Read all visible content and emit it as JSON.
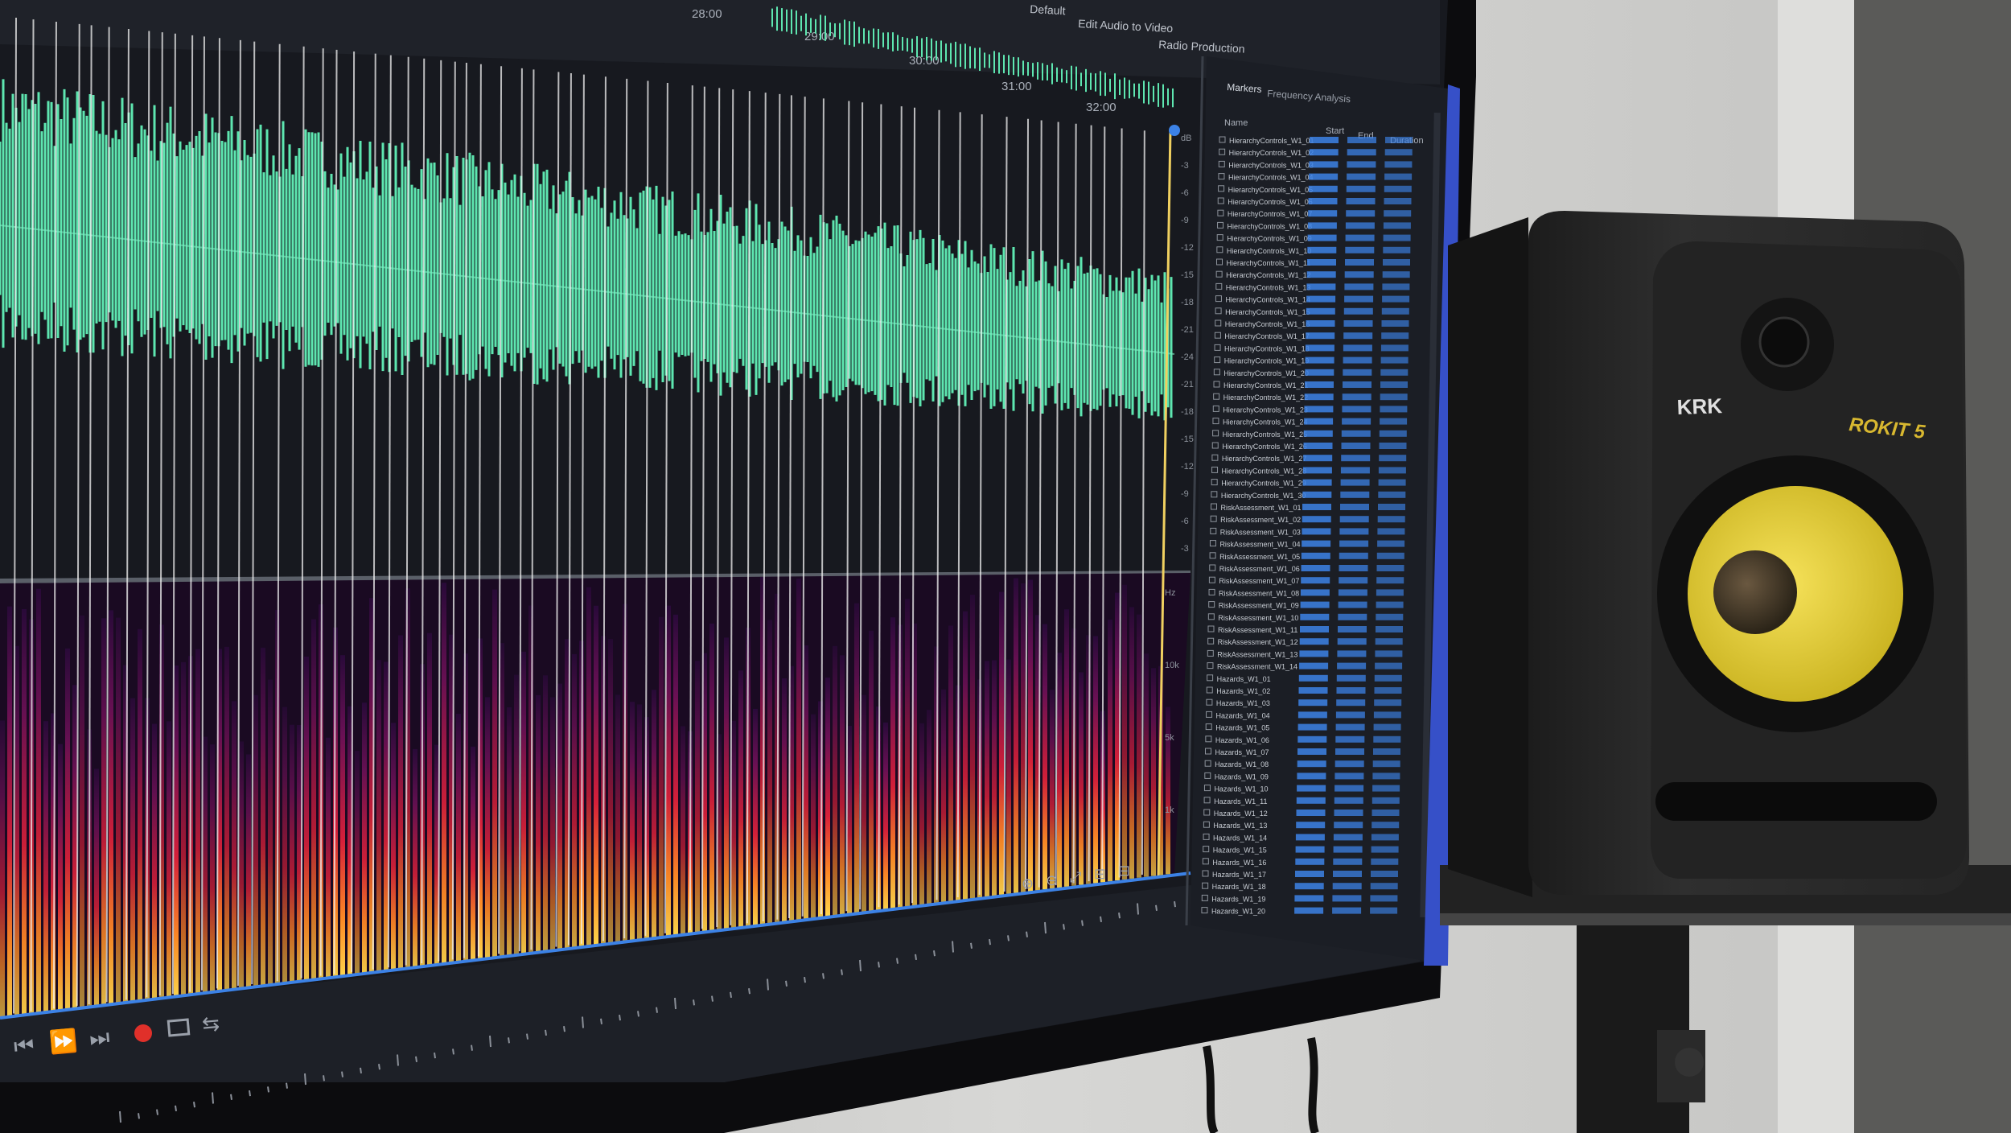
{
  "editor": {
    "workspaces": [
      "Default",
      "Edit Audio to Video",
      "Radio Production"
    ],
    "ruler_marks": [
      "28:00",
      "29:00",
      "30:00",
      "31:00",
      "32:00"
    ],
    "meter_scale": [
      "dB",
      "-3",
      "-6",
      "-9",
      "-12",
      "-15",
      "-18",
      "-21",
      "-24",
      "-21",
      "-18",
      "-15",
      "-12",
      "-9",
      "-6",
      "-3"
    ],
    "hz_scale": [
      "Hz",
      "10k",
      "5k",
      "1k"
    ]
  },
  "markers_panel": {
    "tabs": [
      "Markers",
      "Frequency Analysis"
    ],
    "columns": [
      "Name",
      "Start",
      "End",
      "Duration"
    ],
    "rows": [
      "HierarchyControls_W1_01",
      "HierarchyControls_W1_02",
      "HierarchyControls_W1_03",
      "HierarchyControls_W1_04",
      "HierarchyControls_W1_05",
      "HierarchyControls_W1_06",
      "HierarchyControls_W1_07",
      "HierarchyControls_W1_08",
      "HierarchyControls_W1_09",
      "HierarchyControls_W1_10",
      "HierarchyControls_W1_11",
      "HierarchyControls_W1_12",
      "HierarchyControls_W1_13",
      "HierarchyControls_W1_14",
      "HierarchyControls_W1_15",
      "HierarchyControls_W1_16",
      "HierarchyControls_W1_17",
      "HierarchyControls_W1_18",
      "HierarchyControls_W1_19",
      "HierarchyControls_W1_20",
      "HierarchyControls_W1_21",
      "HierarchyControls_W1_22",
      "HierarchyControls_W1_23",
      "HierarchyControls_W1_24",
      "HierarchyControls_W1_25",
      "HierarchyControls_W1_26",
      "HierarchyControls_W1_27",
      "HierarchyControls_W1_28",
      "HierarchyControls_W1_29",
      "HierarchyControls_W1_30",
      "RiskAssessment_W1_01",
      "RiskAssessment_W1_02",
      "RiskAssessment_W1_03",
      "RiskAssessment_W1_04",
      "RiskAssessment_W1_05",
      "RiskAssessment_W1_06",
      "RiskAssessment_W1_07",
      "RiskAssessment_W1_08",
      "RiskAssessment_W1_09",
      "RiskAssessment_W1_10",
      "RiskAssessment_W1_11",
      "RiskAssessment_W1_12",
      "RiskAssessment_W1_13",
      "RiskAssessment_W1_14",
      "Hazards_W1_01",
      "Hazards_W1_02",
      "Hazards_W1_03",
      "Hazards_W1_04",
      "Hazards_W1_05",
      "Hazards_W1_06",
      "Hazards_W1_07",
      "Hazards_W1_08",
      "Hazards_W1_09",
      "Hazards_W1_10",
      "Hazards_W1_11",
      "Hazards_W1_12",
      "Hazards_W1_13",
      "Hazards_W1_14",
      "Hazards_W1_15",
      "Hazards_W1_16",
      "Hazards_W1_17",
      "Hazards_W1_18",
      "Hazards_W1_19",
      "Hazards_W1_20"
    ]
  },
  "speaker": {
    "brand": "KRK",
    "model": "ROKIT 5"
  },
  "colors": {
    "wall": "#cfcfcd",
    "screen_bg": "#17191f",
    "waveform": "#5ee6b0",
    "spectrogram_hot": "#ffb035",
    "spectrogram_warm": "#d8203a",
    "spectrogram_cool": "#3a1050",
    "accent_blue": "#3c82e6",
    "woofer_yellow": "#e8d23c",
    "speaker_body": "#2a2a2a"
  }
}
